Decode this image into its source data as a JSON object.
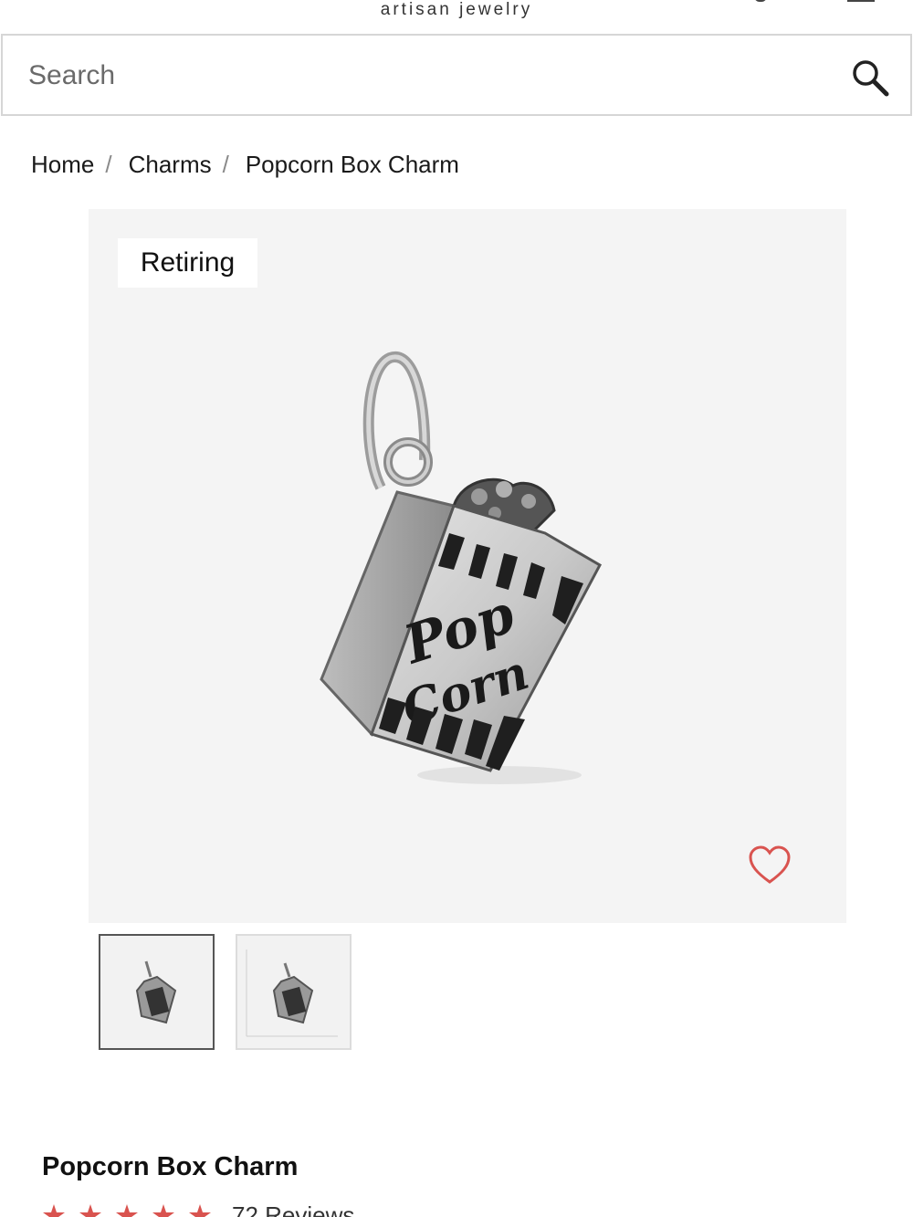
{
  "header": {
    "tagline": "artisan jewelry"
  },
  "search": {
    "placeholder": "Search",
    "icon": "search-icon"
  },
  "breadcrumb": {
    "items": [
      "Home",
      "Charms",
      "Popcorn Box Charm"
    ],
    "separator": "/"
  },
  "product": {
    "badge": "Retiring",
    "name": "Popcorn Box Charm",
    "image_caption_top": "Pop",
    "image_caption_bottom": "Corn",
    "favorite_icon": "heart-icon",
    "rating": {
      "stars": 5,
      "star_color": "#d9534f",
      "review_count_text": "72 Reviews"
    }
  },
  "thumbnails": [
    {
      "name": "thumbnail-front",
      "selected": true
    },
    {
      "name": "thumbnail-scale",
      "selected": false
    }
  ],
  "colors": {
    "accent": "#d9534f",
    "image_background": "#f4f4f4",
    "border": "#d6d6d6"
  }
}
